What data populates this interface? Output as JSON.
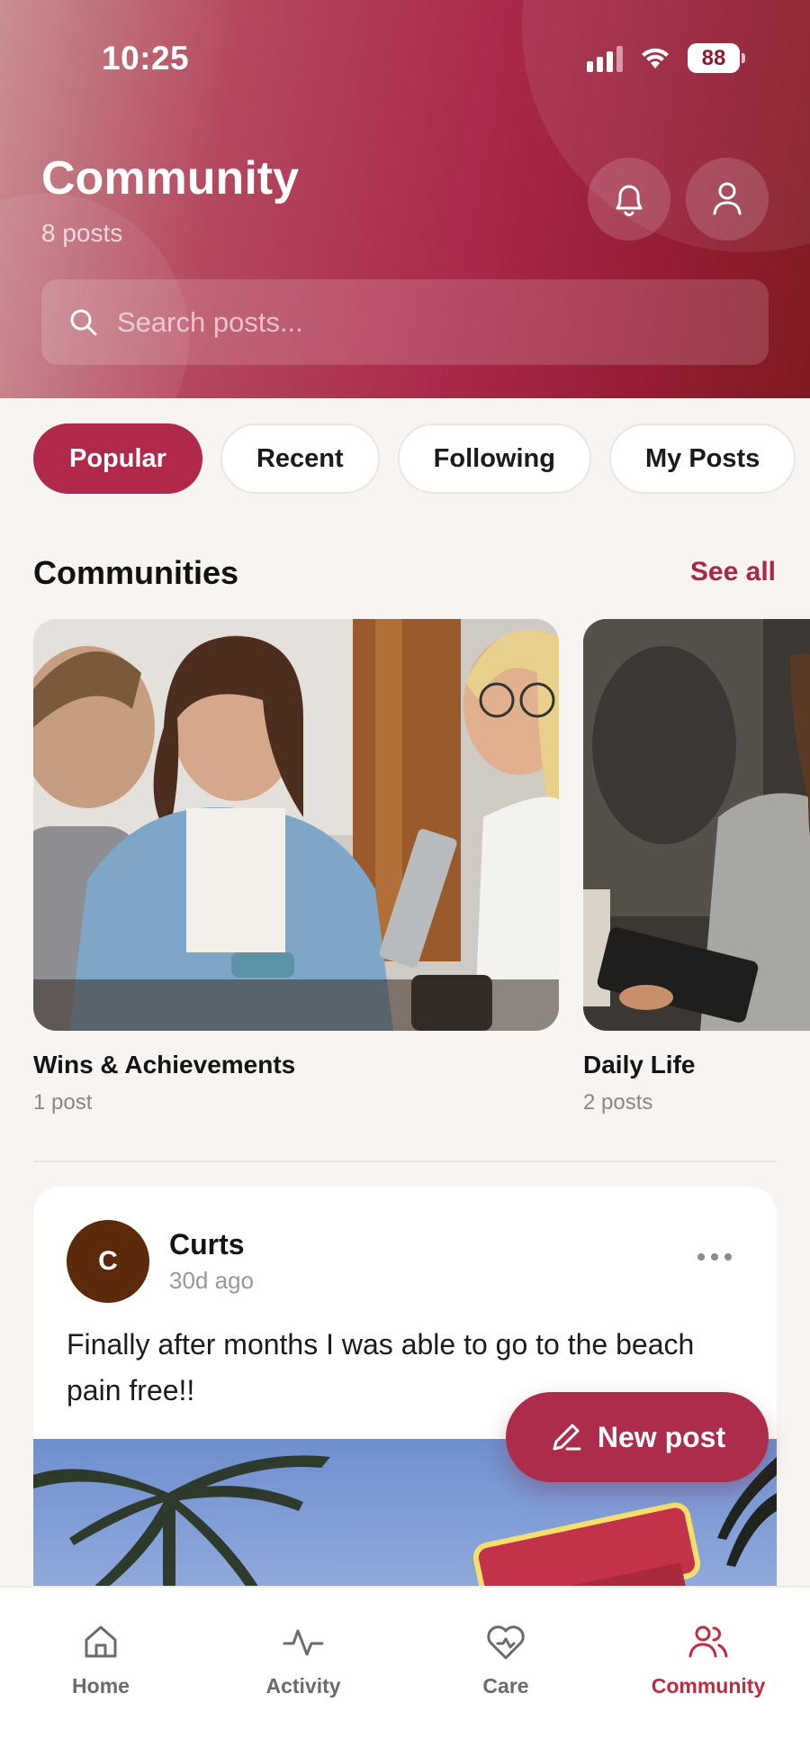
{
  "status_bar": {
    "time": "10:25",
    "battery": "88"
  },
  "header": {
    "title": "Community",
    "subtitle": "8 posts",
    "search_placeholder": "Search posts..."
  },
  "tabs": [
    {
      "label": "Popular",
      "active": true
    },
    {
      "label": "Recent",
      "active": false
    },
    {
      "label": "Following",
      "active": false
    },
    {
      "label": "My Posts",
      "active": false
    }
  ],
  "communities": {
    "title": "Communities",
    "see_all": "See all",
    "items": [
      {
        "name": "Wins & Achievements",
        "count": "1 post"
      },
      {
        "name": "Daily Life",
        "count": "2 posts"
      }
    ]
  },
  "post": {
    "avatar_initial": "C",
    "author": "Curts",
    "time": "30d ago",
    "text": "Finally after months I was able to go to the beach pain free!!"
  },
  "fab": {
    "label": "New post"
  },
  "bottom_nav": [
    {
      "label": "Home",
      "icon": "home-icon",
      "active": false
    },
    {
      "label": "Activity",
      "icon": "activity-icon",
      "active": false
    },
    {
      "label": "Care",
      "icon": "care-icon",
      "active": false
    },
    {
      "label": "Community",
      "icon": "community-icon",
      "active": true
    }
  ],
  "colors": {
    "accent": "#b0294a",
    "nav_active": "#c12a3f",
    "background": "#f7f4f1"
  }
}
